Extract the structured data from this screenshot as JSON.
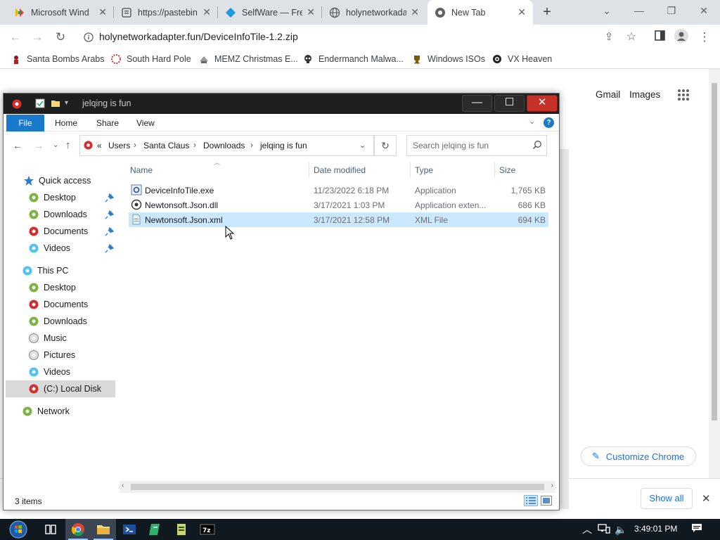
{
  "browser": {
    "tabs": [
      {
        "title": "Microsoft Wind"
      },
      {
        "title": "https://pastebin"
      },
      {
        "title": "SelfWare — Fre"
      },
      {
        "title": "holynetworkada"
      },
      {
        "title": "New Tab"
      }
    ],
    "url": "holynetworkadapter.fun/DeviceInfoTile-1.2.zip",
    "bookmarks": [
      {
        "label": "Santa Bombs Arabs"
      },
      {
        "label": "South Hard Pole"
      },
      {
        "label": "MEMZ Christmas E..."
      },
      {
        "label": "Endermanch Malwa..."
      },
      {
        "label": "Windows ISOs"
      },
      {
        "label": "VX Heaven"
      }
    ],
    "ntp": {
      "gmail": "Gmail",
      "images": "Images",
      "customize": "Customize Chrome"
    },
    "downloads": {
      "show_all": "Show all"
    }
  },
  "explorer": {
    "title": "jelqing is fun",
    "ribbon": {
      "file": "File",
      "home": "Home",
      "share": "Share",
      "view": "View"
    },
    "breadcrumb": [
      "«",
      "Users",
      "Santa Claus",
      "Downloads",
      "jelqing is fun"
    ],
    "search_placeholder": "Search jelqing is fun",
    "nav": {
      "quick_access": "Quick access",
      "qa_items": [
        "Desktop",
        "Downloads",
        "Documents",
        "Videos"
      ],
      "this_pc": "This PC",
      "pc_items": [
        "Desktop",
        "Documents",
        "Downloads",
        "Music",
        "Pictures",
        "Videos",
        "(C:) Local Disk"
      ],
      "network": "Network"
    },
    "columns": {
      "name": "Name",
      "date": "Date modified",
      "type": "Type",
      "size": "Size"
    },
    "files": [
      {
        "name": "DeviceInfoTile.exe",
        "date": "11/23/2022 6:18 PM",
        "type": "Application",
        "size": "1,765 KB"
      },
      {
        "name": "Newtonsoft.Json.dll",
        "date": "3/17/2021 1:03 PM",
        "type": "Application exten...",
        "size": "686 KB"
      },
      {
        "name": "Newtonsoft.Json.xml",
        "date": "3/17/2021 12:58 PM",
        "type": "XML File",
        "size": "694 KB"
      }
    ],
    "status": "3 items"
  },
  "taskbar": {
    "clock": "3:49:01 PM"
  },
  "colors": {
    "accent": "#1979ca",
    "selection": "#cce8ff",
    "taskbar": "#101820"
  }
}
